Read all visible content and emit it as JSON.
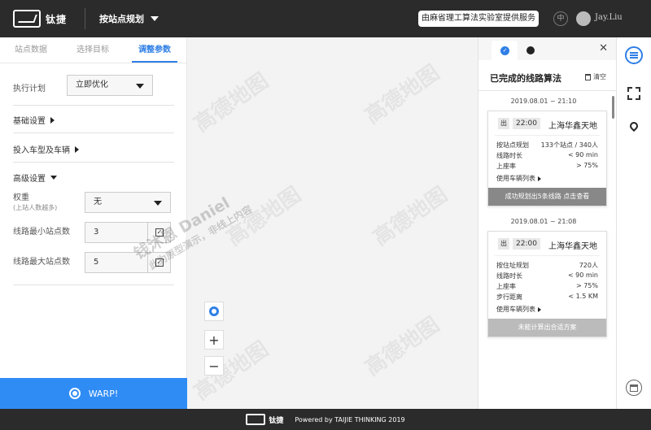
{
  "header": {
    "logo_text": "钛捷",
    "title": "按站点规划",
    "provider": "由麻省理工算法实验室提供服务",
    "lang": "中",
    "user": "Jay.Liu"
  },
  "left": {
    "tabs": [
      {
        "label": "站点数据",
        "active": false
      },
      {
        "label": "选择目标",
        "active": false
      },
      {
        "label": "调整参数",
        "active": true
      }
    ],
    "plan_label": "执行计划",
    "plan_value": "立即优化",
    "basic_settings": "基础设置",
    "vehicles": "投入车型及车辆",
    "advanced": "高级设置",
    "weight_label": "权重",
    "weight_hint": "(上站人数越多)",
    "weight_value": "无",
    "min_stops_label": "线路最小站点数",
    "min_stops_value": "3",
    "max_stops_label": "线路最大站点数",
    "max_stops_value": "5",
    "warp_label": "WARP!"
  },
  "map": {
    "watermark": "高德地图",
    "overlay_name": "钱沐恩 Daniel",
    "overlay_note": "此为原型演示，非线上内容",
    "zoom_in": "+",
    "zoom_out": "−"
  },
  "right": {
    "title": "已完成的线路算法",
    "clear": "清空",
    "cards": [
      {
        "timestamp": "2019.08.01 ~ 21:10",
        "tag": "出",
        "time": "22:00",
        "dest": "上海华鑫天地",
        "rows": [
          {
            "k": "按站点规划",
            "v": "133个站点 / 340人"
          },
          {
            "k": "线路时长",
            "v": "< 90 min"
          },
          {
            "k": "上座率",
            "v": "> 75%"
          }
        ],
        "link": "使用车辆列表",
        "footer": "成功规划出5条线路 点击查看"
      },
      {
        "timestamp": "2019.08.01 ~ 21:08",
        "tag": "出",
        "time": "22:00",
        "dest": "上海华鑫天地",
        "rows": [
          {
            "k": "按住址规划",
            "v": "720人"
          },
          {
            "k": "线路时长",
            "v": "< 90 min"
          },
          {
            "k": "上座率",
            "v": "> 75%"
          },
          {
            "k": "步行距离",
            "v": "< 1.5 KM"
          }
        ],
        "link": "使用车辆列表",
        "footer": "未能计算出合适方案"
      }
    ]
  },
  "footer": {
    "brand": "钛捷",
    "text": "Powered by TAIJIE THINKING 2019"
  },
  "colors": {
    "accent": "#2f7fe6",
    "warp": "#2f8cf5",
    "topbar": "#2b2b2b"
  }
}
